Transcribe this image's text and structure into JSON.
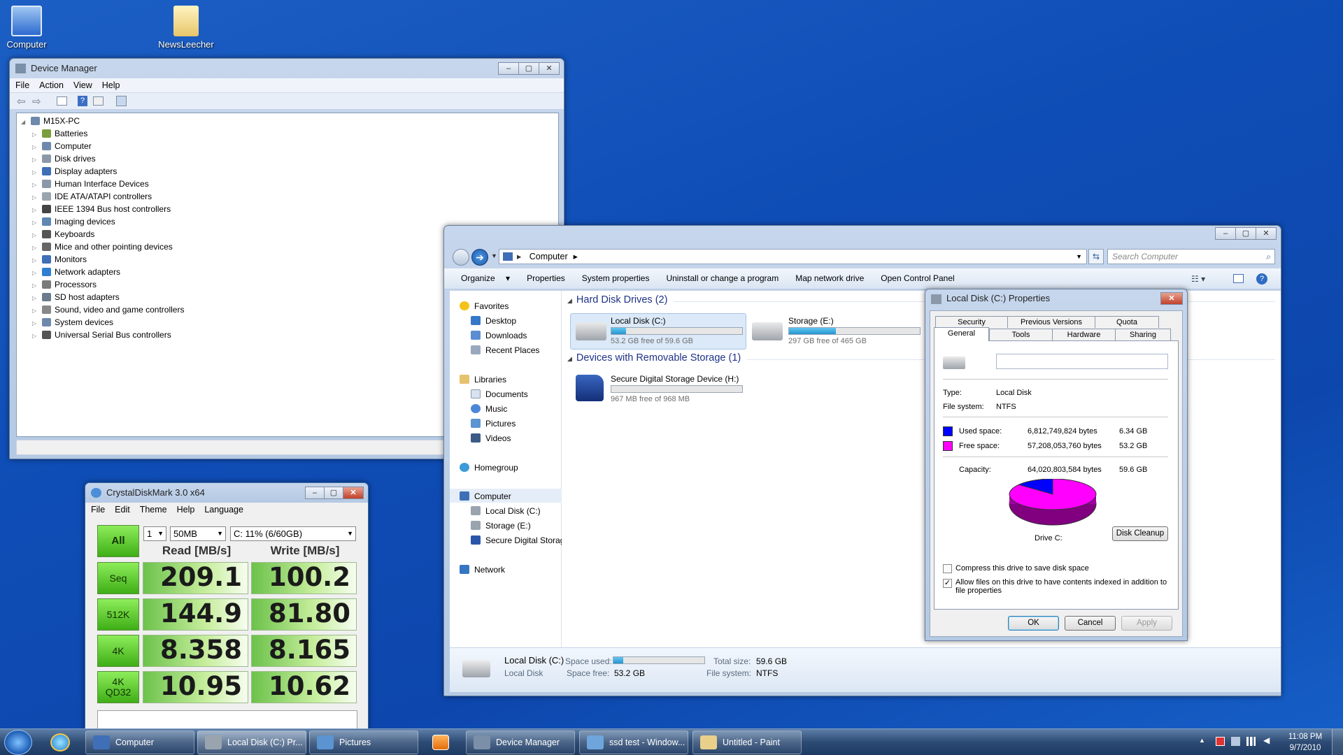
{
  "desktop": {
    "icons": [
      {
        "label": "Computer"
      },
      {
        "label": "NewsLeecher"
      }
    ]
  },
  "device_manager": {
    "title": "Device Manager",
    "menu": [
      "File",
      "Action",
      "View",
      "Help"
    ],
    "root": "M15X-PC",
    "items": [
      "Batteries",
      "Computer",
      "Disk drives",
      "Display adapters",
      "Human Interface Devices",
      "IDE ATA/ATAPI controllers",
      "IEEE 1394 Bus host controllers",
      "Imaging devices",
      "Keyboards",
      "Mice and other pointing devices",
      "Monitors",
      "Network adapters",
      "Processors",
      "SD host adapters",
      "Sound, video and game controllers",
      "System devices",
      "Universal Serial Bus controllers"
    ]
  },
  "explorer": {
    "address": "Computer",
    "search_placeholder": "Search Computer",
    "commands": [
      "Organize",
      "Properties",
      "System properties",
      "Uninstall or change a program",
      "Map network drive",
      "Open Control Panel"
    ],
    "nav": {
      "favorites": "Favorites",
      "desktop": "Desktop",
      "downloads": "Downloads",
      "recent": "Recent Places",
      "libraries": "Libraries",
      "documents": "Documents",
      "music": "Music",
      "pictures": "Pictures",
      "videos": "Videos",
      "homegroup": "Homegroup",
      "computer": "Computer",
      "local_c": "Local Disk (C:)",
      "storage_e": "Storage (E:)",
      "sd": "Secure Digital Storag",
      "network": "Network"
    },
    "hdd_group": "Hard Disk Drives (2)",
    "removable_group": "Devices with Removable Storage (1)",
    "drives": [
      {
        "name": "Local Disk (C:)",
        "free": "53.2 GB free of 59.6 GB",
        "used_fraction": 0.11
      },
      {
        "name": "Storage (E:)",
        "free": "297 GB free of 465 GB",
        "used_fraction": 0.36
      },
      {
        "name": "Secure Digital Storage Device (H:)",
        "free": "967 MB free of 968 MB",
        "used_fraction": 0.0
      }
    ],
    "details": {
      "name": "Local Disk (C:)",
      "type": "Local Disk",
      "space_used_label": "Space used:",
      "space_free_label": "Space free:",
      "space_free": "53.2 GB",
      "total_label": "Total size:",
      "total": "59.6 GB",
      "fs_label": "File system:",
      "fs": "NTFS",
      "used_fraction": 0.11
    }
  },
  "properties": {
    "title": "Local Disk (C:) Properties",
    "tabs_top": [
      "Security",
      "Previous Versions",
      "Quota"
    ],
    "tabs_bottom": [
      "General",
      "Tools",
      "Hardware",
      "Sharing"
    ],
    "type_label": "Type:",
    "type": "Local Disk",
    "fs_label": "File system:",
    "fs": "NTFS",
    "used_label": "Used space:",
    "used_bytes": "6,812,749,824 bytes",
    "used_gb": "6.34 GB",
    "free_label": "Free space:",
    "free_bytes": "57,208,053,760 bytes",
    "free_gb": "53.2 GB",
    "cap_label": "Capacity:",
    "cap_bytes": "64,020,803,584 bytes",
    "cap_gb": "59.6 GB",
    "drive_label": "Drive C:",
    "cleanup": "Disk Cleanup",
    "compress": "Compress this drive to save disk space",
    "index_1": "Allow files on this drive to have contents indexed in addition to",
    "index_2": "file properties",
    "ok": "OK",
    "cancel": "Cancel",
    "apply": "Apply",
    "used_color": "#0000ff",
    "free_color": "#ff00ff",
    "used_fraction": 0.106
  },
  "cdm": {
    "title": "CrystalDiskMark 3.0 x64",
    "menu": [
      "File",
      "Edit",
      "Theme",
      "Help",
      "Language"
    ],
    "all": "All",
    "count": "1",
    "size": "50MB",
    "drive": "C: 11% (6/60GB)",
    "read_header": "Read [MB/s]",
    "write_header": "Write [MB/s]",
    "rows": [
      {
        "label": "Seq",
        "read": "209.1",
        "write": "100.2"
      },
      {
        "label": "512K",
        "read": "144.9",
        "write": "81.80"
      },
      {
        "label": "4K",
        "read": "8.358",
        "write": "8.165"
      },
      {
        "label": "4K\nQD32",
        "read": "10.95",
        "write": "10.62"
      }
    ]
  },
  "taskbar": {
    "items": [
      "Computer",
      "Local Disk (C:) Pr...",
      "Pictures",
      "Device Manager",
      "ssd test - Window...",
      "Untitled - Paint"
    ],
    "time": "11:08 PM",
    "date": "9/7/2010"
  }
}
